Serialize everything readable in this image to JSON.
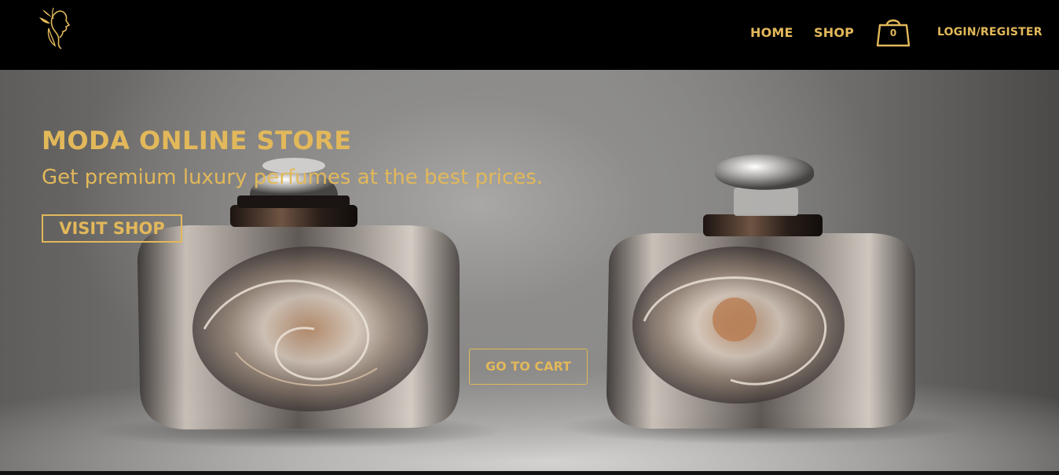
{
  "nav": {
    "logo_icon": "woman-face-leaf-logo",
    "home_label": "HOME",
    "shop_label": "SHOP",
    "cart_icon": "shopping-bag-icon",
    "cart_count": "0",
    "login_label": "LOGIN/REGISTER"
  },
  "hero": {
    "title": "MODA ONLINE STORE",
    "subtitle": "Get premium luxury perfumes at the best prices.",
    "visit_button": "VISIT SHOP",
    "cart_button": "GO TO CART",
    "image": "two-perfume-bottles"
  },
  "colors": {
    "accent": "#e2b85a",
    "navbar_bg": "#000000"
  }
}
